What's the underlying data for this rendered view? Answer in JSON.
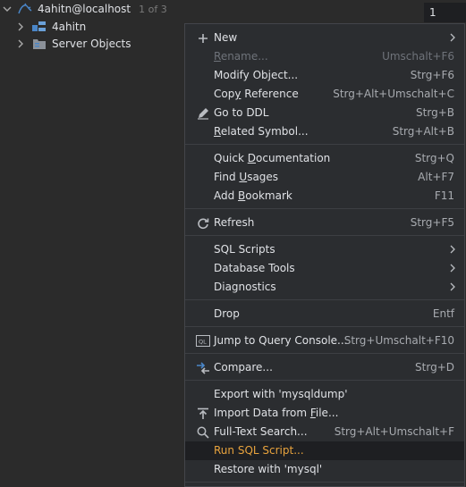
{
  "tree": {
    "root": {
      "label": "4ahitn@localhost",
      "counter": "1 of 3"
    },
    "children": [
      {
        "label": "4ahitn"
      },
      {
        "label": "Server Objects"
      }
    ]
  },
  "editor": {
    "line_number": "1"
  },
  "menu": {
    "new": {
      "label": "New"
    },
    "rename": {
      "pre": "",
      "ul": "R",
      "post": "ename...",
      "shortcut": "Umschalt+F6"
    },
    "modify": {
      "label": "Modify Object...",
      "shortcut": "Strg+F6"
    },
    "copy_reference": {
      "pre": "Cop",
      "ul": "y",
      "post": " Reference",
      "shortcut": "Strg+Alt+Umschalt+C"
    },
    "go_to_ddl": {
      "label": "Go to DDL",
      "shortcut": "Strg+B"
    },
    "related_symbol": {
      "pre": "",
      "ul": "R",
      "post": "elated Symbol...",
      "shortcut": "Strg+Alt+B"
    },
    "quick_doc": {
      "pre": "Quick ",
      "ul": "D",
      "post": "ocumentation",
      "shortcut": "Strg+Q"
    },
    "find_usages": {
      "pre": "Find ",
      "ul": "U",
      "post": "sages",
      "shortcut": "Alt+F7"
    },
    "add_bookmark": {
      "pre": "Add ",
      "ul": "B",
      "post": "ookmark",
      "shortcut": "F11"
    },
    "refresh": {
      "label": "Refresh",
      "shortcut": "Strg+F5"
    },
    "sql_scripts": {
      "label": "SQL Scripts"
    },
    "database_tools": {
      "label": "Database Tools"
    },
    "diagnostics": {
      "label": "Diagnostics"
    },
    "drop": {
      "label": "Drop",
      "shortcut": "Entf"
    },
    "jump_console": {
      "label": "Jump to Query Console...",
      "shortcut": "Strg+Umschalt+F10"
    },
    "compare": {
      "label": "Compare...",
      "shortcut": "Strg+D"
    },
    "export_mysqldump": {
      "label": "Export with 'mysqldump'"
    },
    "import_data": {
      "pre": "Import Data from ",
      "ul": "F",
      "post": "ile..."
    },
    "full_text_search": {
      "label": "Full-Text Search...",
      "shortcut": "Strg+Alt+Umschalt+F"
    },
    "run_sql_script": {
      "label": "Run SQL Script..."
    },
    "restore_mysql": {
      "label": "Restore with 'mysql'"
    }
  },
  "colors": {
    "selected_text": "#e8a33d",
    "datasource_icon": "#4a86c8"
  }
}
